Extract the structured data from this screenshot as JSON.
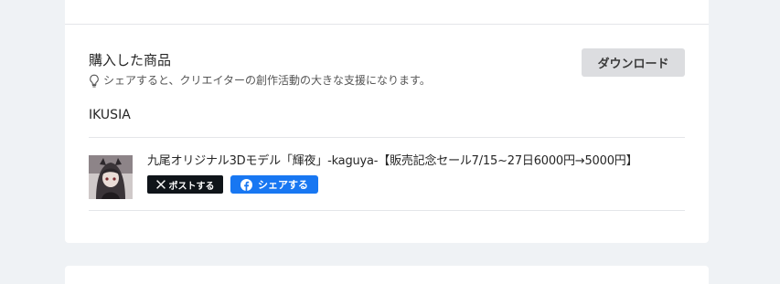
{
  "purchase": {
    "section_title": "購入した商品",
    "hint_text": "シェアすると、クリエイターの創作活動の大きな支援になります。",
    "download_label": "ダウンロード",
    "shop_name": "IKUSIA",
    "product": {
      "title": "九尾オリジナル3Dモデル「輝夜」-kaguya-【販売記念セール7/15~27日6000円→5000円】",
      "thumbnail_icon": "product-thumbnail"
    },
    "share": {
      "x_label": "ポストする",
      "facebook_label": "シェアする"
    }
  },
  "colors": {
    "page_background": "#eff2f5",
    "card_background": "#ffffff",
    "download_button": "#dcdde0",
    "x_button": "#0f1419",
    "facebook_button": "#1877f2"
  },
  "icons": {
    "hint": "lightbulb-icon",
    "x": "x-logo-icon",
    "facebook": "facebook-logo-icon"
  }
}
